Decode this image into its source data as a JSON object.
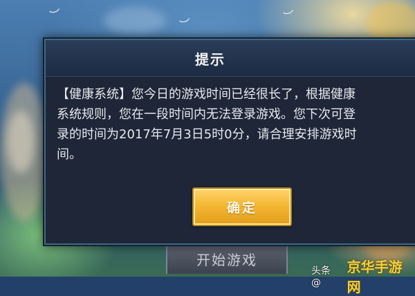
{
  "dialog": {
    "title": "提示",
    "message_lines": [
      "【健康系统】您今日的游戏时间已经很长了，根据健康",
      "系统规则，您在一段时间内无法登录游戏。您下次可登",
      "录的时间为2017年7月3日5时0分，请合理安排游戏时",
      "间。"
    ],
    "confirm_label": "确定"
  },
  "background": {
    "start_button_label": "开始游戏"
  },
  "watermark": {
    "label": "头条 @",
    "brand": "京华手游网"
  },
  "colors": {
    "dialog_bg": "#1e2638",
    "dialog_border": "#3d6a86",
    "confirm_gold": "#f4b834",
    "watermark_yellow": "#f2d03b"
  }
}
